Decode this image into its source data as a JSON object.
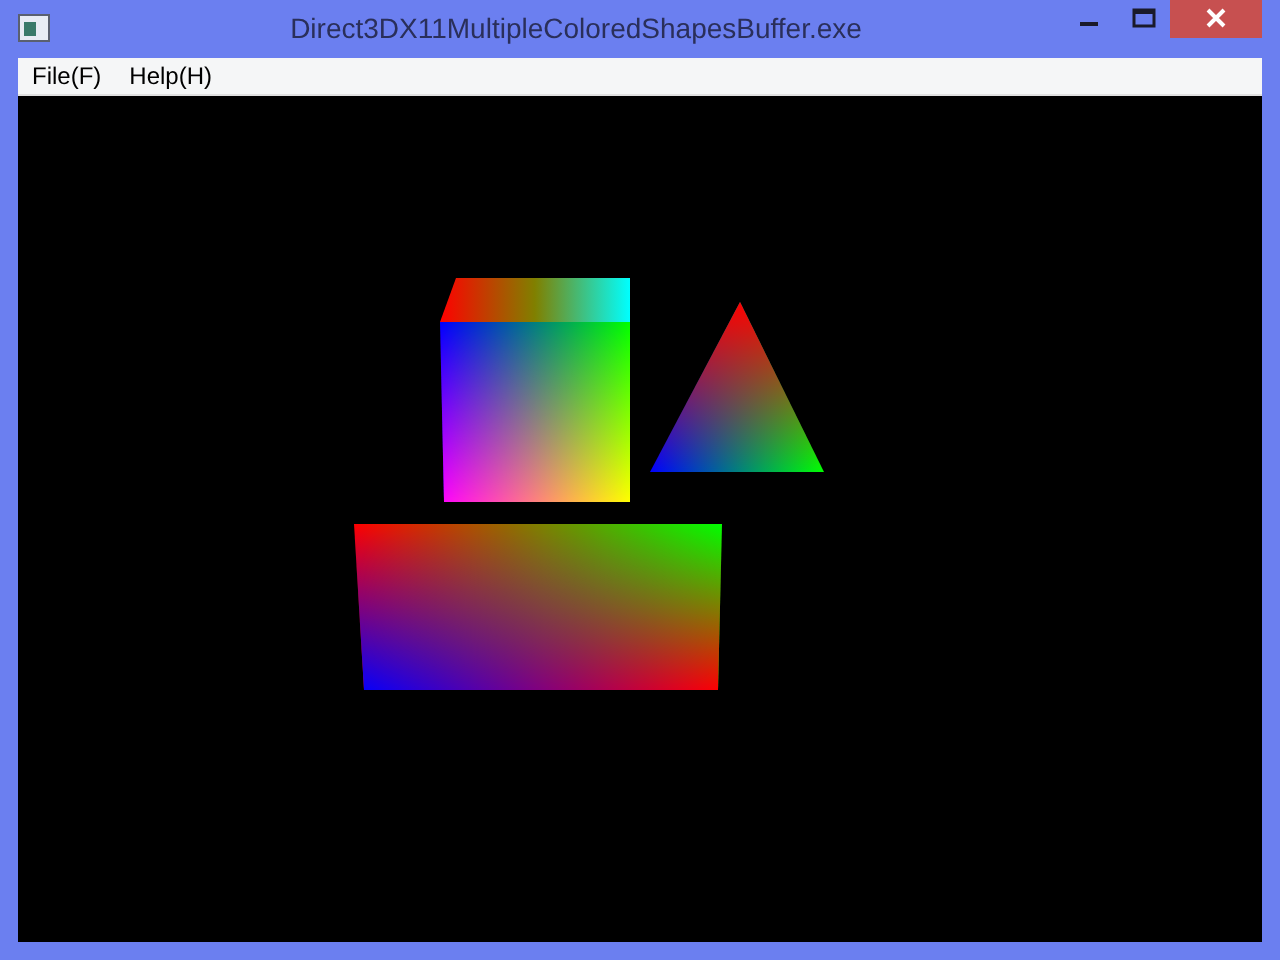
{
  "window": {
    "title": "Direct3DX11MultipleColoredShapesBuffer.exe"
  },
  "menu": [
    {
      "label": "File(F)"
    },
    {
      "label": "Help(H)"
    }
  ]
}
